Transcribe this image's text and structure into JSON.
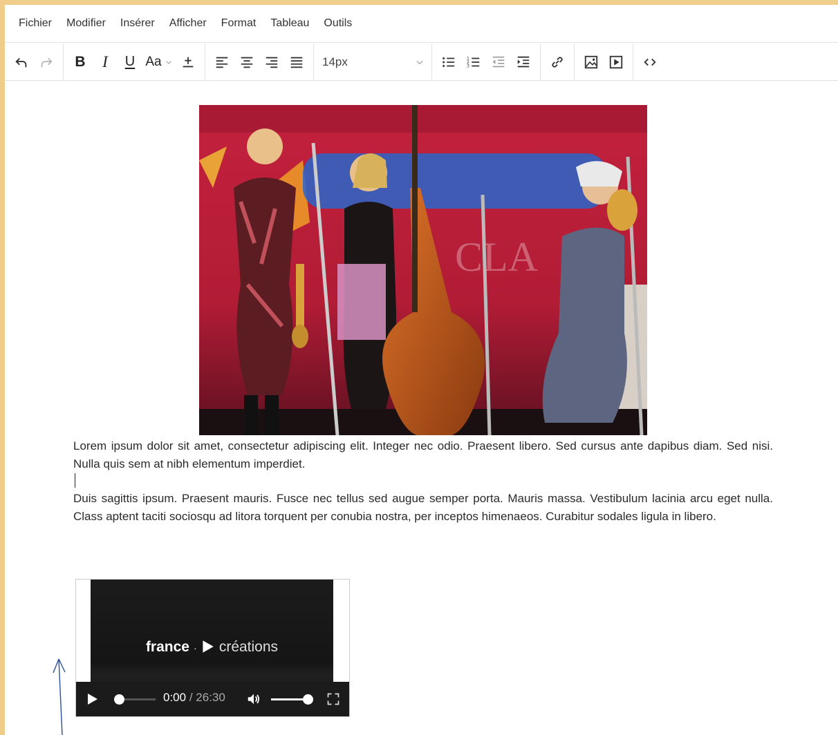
{
  "menu": [
    "Fichier",
    "Modifier",
    "Insérer",
    "Afficher",
    "Format",
    "Tableau",
    "Outils"
  ],
  "toolbar": {
    "undo_icon": "undo-icon",
    "redo_icon": "redo-icon",
    "bold": "B",
    "italic": "I",
    "underline": "U",
    "font_case": "Aa",
    "font_size": "14px",
    "icons": [
      "undo-icon",
      "redo-icon",
      "bold-icon",
      "italic-icon",
      "underline-icon",
      "font-case-icon",
      "insert-icon",
      "align-left-icon",
      "align-center-icon",
      "align-right-icon",
      "align-justify-icon",
      "bullet-list-icon",
      "numbered-list-icon",
      "outdent-icon",
      "indent-icon",
      "link-icon",
      "image-icon",
      "video-icon",
      "code-icon"
    ]
  },
  "content": {
    "paragraph1": "Lorem ipsum dolor sit amet, consectetur adipiscing elit. Integer nec odio. Praesent libero. Sed cursus ante dapibus diam. Sed nisi. Nulla quis sem at nibh elementum imperdiet.",
    "paragraph2": "Duis sagittis ipsum. Praesent mauris. Fusce nec tellus sed augue semper porta. Mauris massa. Vestibulum lacinia arcu eget nulla. Class aptent taciti sociosqu ad litora torquent per conubia nostra, per inceptos himenaeos. Curabitur sodales ligula in libero."
  },
  "video": {
    "logo_left": "france",
    "logo_right": "créations",
    "current_time": "0:00",
    "duration": "/ 26:30",
    "progress": 0.0,
    "volume": 0.85
  },
  "colors": {
    "frame_border": "#f0cd8a",
    "annotation_arrow": "#2b4e9e",
    "spell_underline": "#d93025"
  }
}
